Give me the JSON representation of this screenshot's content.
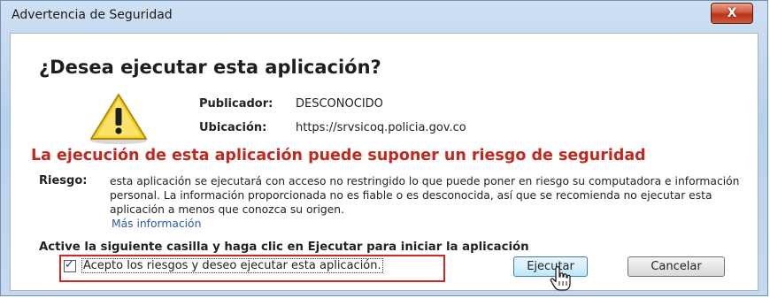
{
  "window": {
    "title": "Advertencia de Seguridad",
    "close_symbol": "X"
  },
  "dialog": {
    "heading": "¿Desea ejecutar esta aplicación?",
    "publisher_label": "Publicador:",
    "publisher_value": "DESCONOCIDO",
    "location_label": "Ubicación:",
    "location_value": "https://srvsicoq.policia.gov.co",
    "risk_title": "La ejecución de esta aplicación puede suponer un riesgo de seguridad",
    "risk_label": "Riesgo:",
    "risk_text": "esta aplicación se ejecutará con acceso no restringido lo que puede poner en riesgo su computadora e información personal. La información proporcionada no es fiable o es desconocida, así que se recomienda no ejecutar esta aplicación a menos que conozca su origen.",
    "more_info": "Más información",
    "instruction": "Active la siguiente casilla y haga clic en Ejecutar para iniciar la aplicación",
    "checkbox_label": "Acepto los riesgos y deseo ejecutar esta aplicación.",
    "checkbox_checked": true,
    "run_button": "Ejecutar",
    "cancel_button": "Cancelar"
  },
  "icons": {
    "warning": "warning-triangle-icon",
    "cursor": "hand-pointer-icon"
  },
  "colors": {
    "risk_red": "#c2281e",
    "link_blue": "#2a5ab3",
    "highlight_box": "#d02626"
  }
}
